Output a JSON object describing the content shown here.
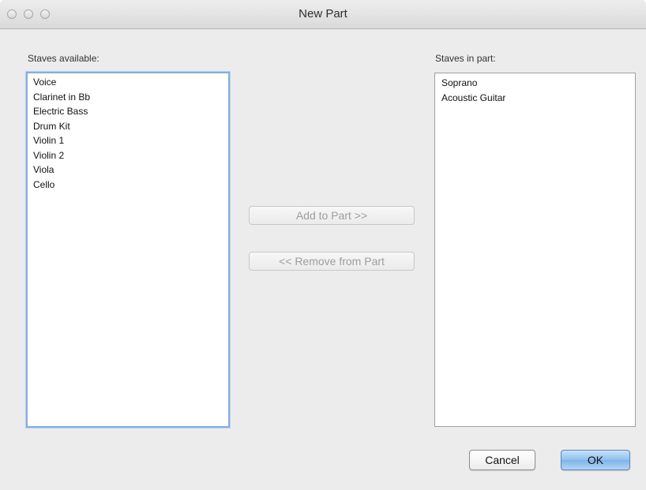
{
  "window": {
    "title": "New Part"
  },
  "available": {
    "label": "Staves available:",
    "items": [
      "Voice",
      "Clarinet in Bb",
      "Electric Bass",
      "Drum Kit",
      "Violin 1",
      "Violin 2",
      "Viola",
      "Cello"
    ]
  },
  "in_part": {
    "label": "Staves in part:",
    "items": [
      "Soprano",
      "Acoustic Guitar"
    ]
  },
  "actions": {
    "add_label": "Add to Part >>",
    "remove_label": "<< Remove from Part"
  },
  "footer": {
    "cancel_label": "Cancel",
    "ok_label": "OK"
  }
}
